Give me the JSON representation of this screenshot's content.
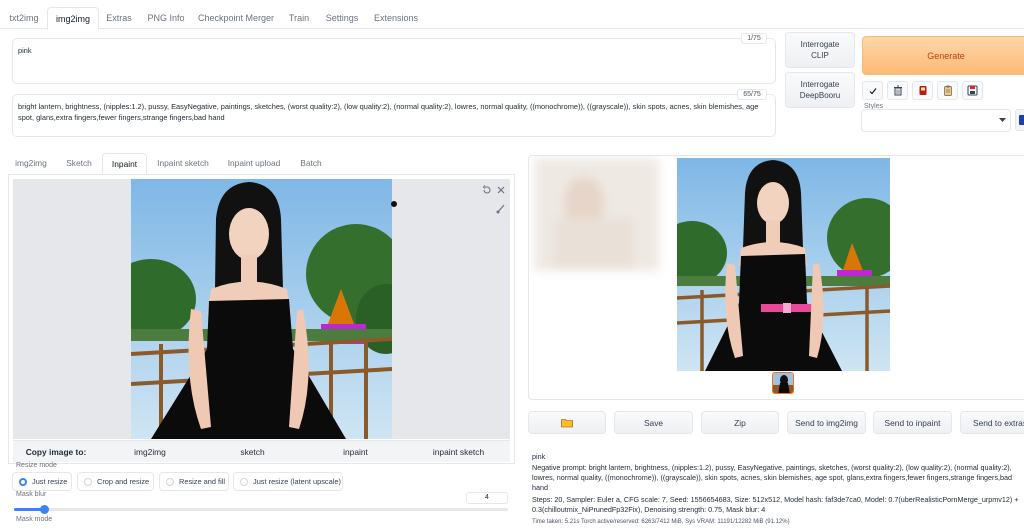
{
  "top_tabs": [
    "txt2img",
    "img2img",
    "Extras",
    "PNG Info",
    "Checkpoint Merger",
    "Train",
    "Settings",
    "Extensions"
  ],
  "prompt": {
    "value": "pink",
    "counter": "1/75"
  },
  "negative_prompt": {
    "value": "bright lantern, brightness, (nipples:1.2), pussy, EasyNegative, paintings, sketches, (worst quality:2), (low quality:2), (normal quality:2), lowres, normal quality, ((monochrome)), ((grayscale)), skin spots, acnes, skin blemishes, age spot, glans,extra fingers,fewer fingers,strange fingers,bad hand",
    "counter": "65/75"
  },
  "interrogate": {
    "clip": "Interrogate CLIP",
    "deepbooru": "Interrogate DeepBooru"
  },
  "generate_label": "Generate",
  "tool_icons": [
    "check-icon",
    "trash-icon",
    "red-book-icon",
    "clipboard-icon",
    "save-style-icon"
  ],
  "styles_label": "Styles",
  "sub_tabs": [
    "img2img",
    "Sketch",
    "Inpaint",
    "Inpaint sketch",
    "Inpaint upload",
    "Batch"
  ],
  "copy_bar": {
    "label": "Copy image to:",
    "targets": [
      "img2img",
      "sketch",
      "inpaint",
      "inpaint sketch"
    ]
  },
  "resize_mode": {
    "label": "Resize mode",
    "options": [
      "Just resize",
      "Crop and resize",
      "Resize and fill",
      "Just resize (latent upscale)"
    ],
    "selected": "Just resize"
  },
  "mask_blur": {
    "label": "Mask blur",
    "value": "4",
    "fraction": 0.06
  },
  "mask_mode_label": "Mask mode",
  "output_buttons": [
    "",
    "Save",
    "Zip",
    "Send to img2img",
    "Send to inpaint",
    "Send to extras"
  ],
  "info": {
    "prompt": "pink",
    "negative": "Negative prompt: bright lantern, brightness, (nipples:1.2), pussy, EasyNegative, paintings, sketches, (worst quality:2), (low quality:2), (normal quality:2), lowres, normal quality, ((monochrome)), ((grayscale)), skin spots, acnes, skin blemishes, age spot, glans,extra fingers,fewer fingers,strange fingers,bad hand",
    "params": "Steps: 20, Sampler: Euler a, CFG scale: 7, Seed: 1556654683, Size: 512x512, Model hash: faf3de7ca0, Model: 0.7(uberRealisticPornMerge_urpmv12) + 0.3(chilloutmix_NiPrunedFp32Fix), Denoising strength: 0.75, Mask blur: 4",
    "time": "Time taken: 5.21s  Torch active/reserved: 6263/7412 MiB, Sys VRAM: 11191/12282 MiB (91.12%)"
  }
}
